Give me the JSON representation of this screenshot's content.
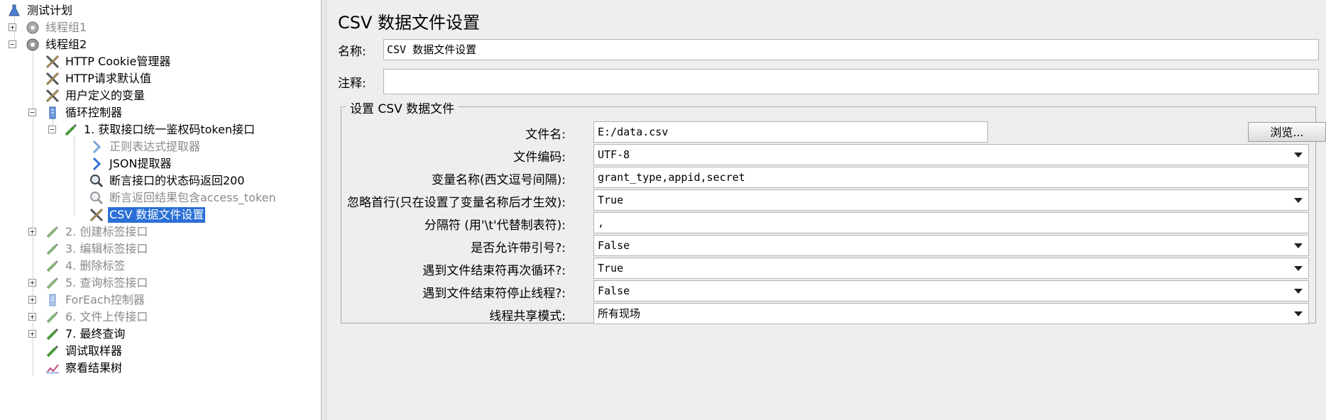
{
  "tree": {
    "root": "测试计划",
    "items": [
      {
        "label": "线程组1",
        "disabled": true
      },
      {
        "label": "线程组2"
      },
      {
        "label": "HTTP Cookie管理器"
      },
      {
        "label": "HTTP请求默认值"
      },
      {
        "label": "用户定义的变量"
      },
      {
        "label": "循环控制器"
      },
      {
        "label": "1. 获取接口统一鉴权码token接口"
      },
      {
        "label": "正则表达式提取器",
        "disabled": true
      },
      {
        "label": "JSON提取器"
      },
      {
        "label": "断言接口的状态码返回200"
      },
      {
        "label": "断言返回结果包含access_token",
        "disabled": true
      },
      {
        "label": "CSV 数据文件设置",
        "selected": true
      },
      {
        "label": "2. 创建标签接口",
        "disabled": true
      },
      {
        "label": "3. 编辑标签接口",
        "disabled": true
      },
      {
        "label": "4. 删除标签",
        "disabled": true
      },
      {
        "label": "5. 查询标签接口",
        "disabled": true
      },
      {
        "label": "ForEach控制器",
        "disabled": true
      },
      {
        "label": "6. 文件上传接口",
        "disabled": true
      },
      {
        "label": "7. 最终查询"
      },
      {
        "label": "调试取样器"
      },
      {
        "label": "察看结果树"
      }
    ]
  },
  "panel": {
    "title": "CSV 数据文件设置",
    "name_label": "名称:",
    "name_value": "CSV 数据文件设置",
    "comment_label": "注释:",
    "comment_value": "",
    "group_title": "设置 CSV 数据文件",
    "fields": [
      {
        "label": "文件名:",
        "value": "E:/data.csv",
        "kind": "text",
        "button": "浏览..."
      },
      {
        "label": "文件编码:",
        "value": "UTF-8",
        "kind": "combo"
      },
      {
        "label": "变量名称(西文逗号间隔):",
        "value": "grant_type,appid,secret",
        "kind": "text"
      },
      {
        "label": "忽略首行(只在设置了变量名称后才生效):",
        "value": "True",
        "kind": "combo"
      },
      {
        "label": "分隔符 (用'\\t'代替制表符):",
        "value": ",",
        "kind": "text"
      },
      {
        "label": "是否允许带引号?:",
        "value": "False",
        "kind": "combo"
      },
      {
        "label": "遇到文件结束符再次循环?:",
        "value": "True",
        "kind": "combo"
      },
      {
        "label": "遇到文件结束符停止线程?:",
        "value": "False",
        "kind": "combo"
      },
      {
        "label": "线程共享模式:",
        "value": "所有现场",
        "kind": "combo"
      }
    ]
  }
}
